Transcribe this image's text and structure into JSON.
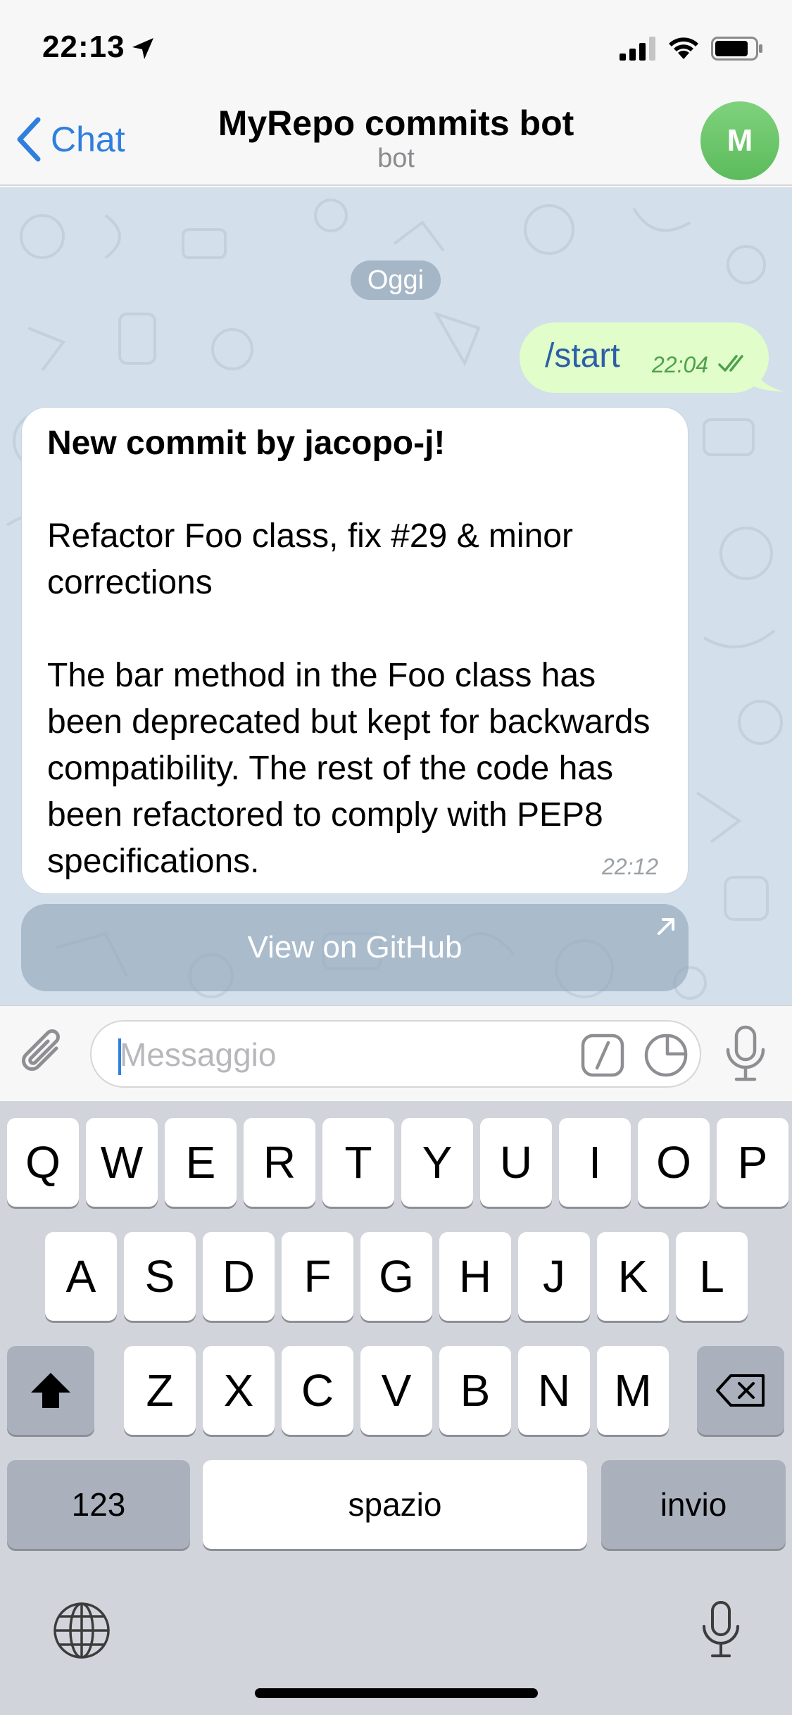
{
  "status_bar": {
    "time": "22:13"
  },
  "nav": {
    "back_label": "Chat",
    "title": "MyRepo commits bot",
    "subtitle": "bot",
    "avatar_letter": "M"
  },
  "chat": {
    "date_separator": "Oggi",
    "outgoing": {
      "text": "/start",
      "time": "22:04"
    },
    "incoming": {
      "title": "New commit by jacopo-j!",
      "paragraph1": "Refactor Foo class, fix #29 & minor corrections",
      "paragraph2": "The bar method in the Foo class has been deprecated but kept for backwards compatibility. The rest of the code has been refactored to comply with PEP8 specifications.",
      "time": "22:12"
    },
    "inline_button": "View on GitHub"
  },
  "input": {
    "placeholder": "Messaggio",
    "value": ""
  },
  "keyboard": {
    "row1": [
      "Q",
      "W",
      "E",
      "R",
      "T",
      "Y",
      "U",
      "I",
      "O",
      "P"
    ],
    "row2": [
      "A",
      "S",
      "D",
      "F",
      "G",
      "H",
      "J",
      "K",
      "L"
    ],
    "row3": [
      "Z",
      "X",
      "C",
      "V",
      "B",
      "N",
      "M"
    ],
    "numbers_label": "123",
    "space_label": "spazio",
    "return_label": "invio"
  },
  "colors": {
    "accent": "#2f7fde",
    "outgoing_bubble": "#e1fdc9",
    "chat_background": "#d3dfea",
    "avatar": "#5cbb5c"
  },
  "icons": [
    "location-arrow-icon",
    "signal-icon",
    "wifi-icon",
    "battery-icon",
    "chevron-left-icon",
    "attachment-icon",
    "command-icon",
    "sticker-icon",
    "microphone-icon",
    "shift-icon",
    "backspace-icon",
    "globe-icon",
    "external-link-icon",
    "double-check-icon"
  ]
}
